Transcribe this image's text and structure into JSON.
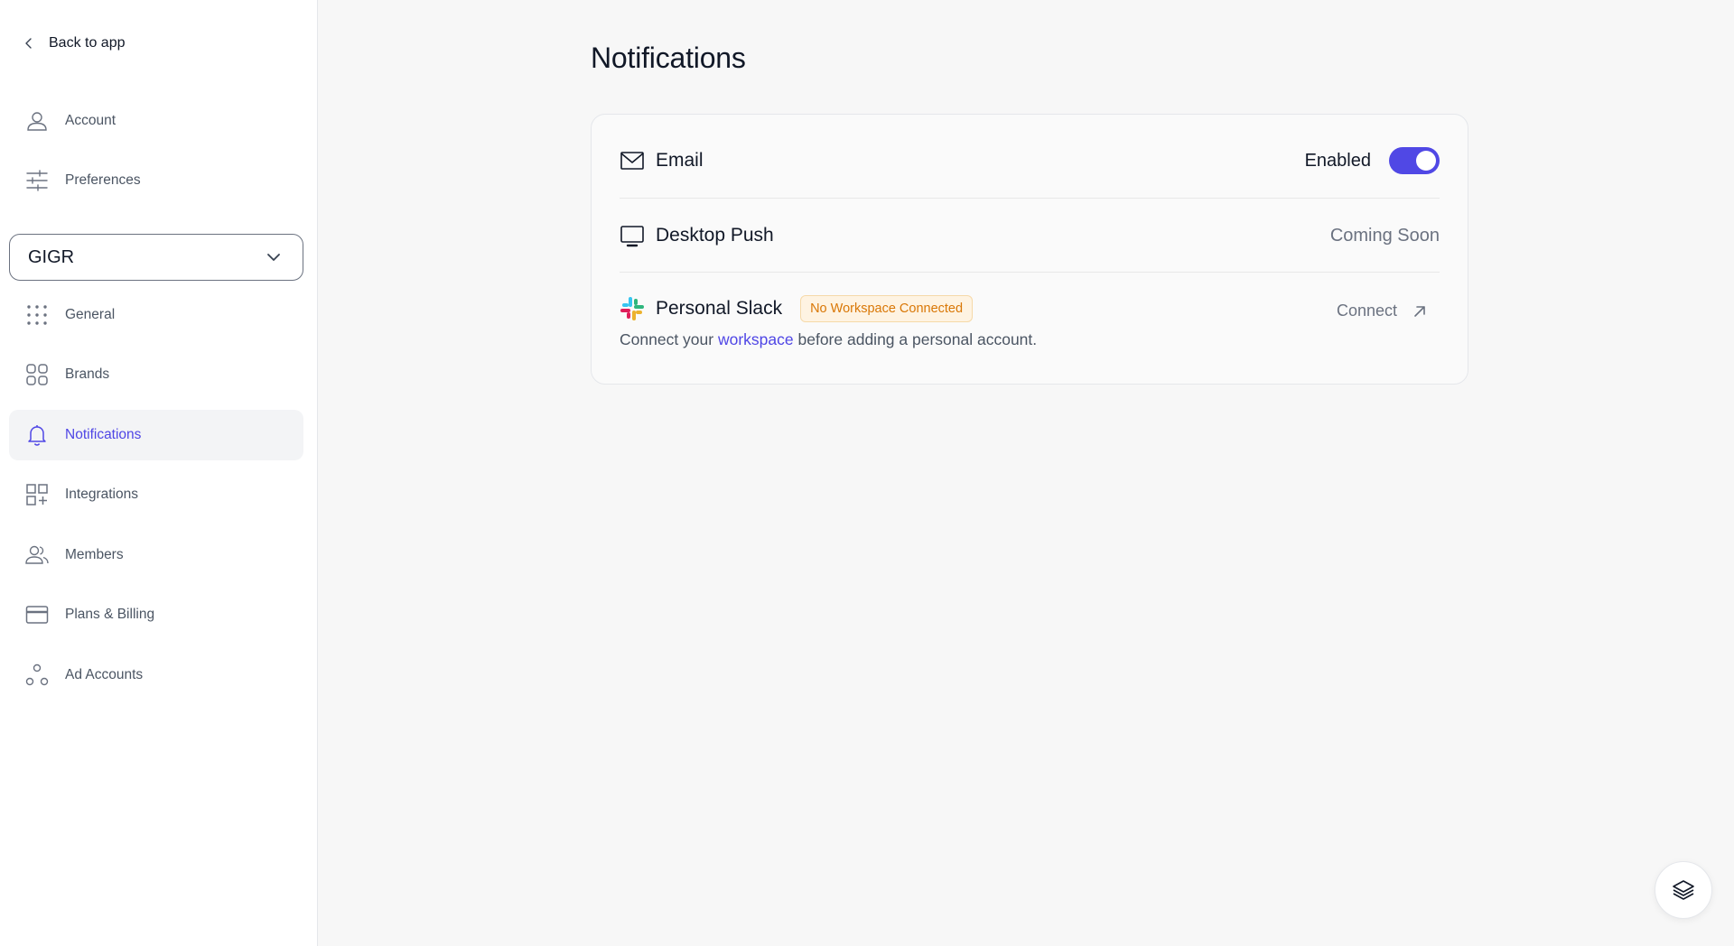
{
  "sidebar": {
    "back_label": "Back to app",
    "items_top": [
      {
        "label": "Account",
        "icon": "user-icon"
      },
      {
        "label": "Preferences",
        "icon": "sliders-icon"
      }
    ],
    "workspace": {
      "selected": "GIGR"
    },
    "items_workspace": [
      {
        "label": "General",
        "icon": "dots-grid-icon"
      },
      {
        "label": "Brands",
        "icon": "grid-four-icon"
      },
      {
        "label": "Notifications",
        "icon": "bell-icon",
        "active": true
      },
      {
        "label": "Integrations",
        "icon": "grid-plus-icon"
      },
      {
        "label": "Members",
        "icon": "users-icon"
      },
      {
        "label": "Plans & Billing",
        "icon": "credit-card-icon"
      },
      {
        "label": "Ad Accounts",
        "icon": "nodes-icon"
      }
    ]
  },
  "main": {
    "title": "Notifications",
    "email": {
      "label": "Email",
      "status": "Enabled",
      "enabled": true
    },
    "desktop_push": {
      "label": "Desktop Push",
      "status": "Coming Soon"
    },
    "slack": {
      "label": "Personal Slack",
      "badge": "No Workspace Connected",
      "desc_before": "Connect your",
      "desc_link": "workspace",
      "desc_after": "before adding a personal account.",
      "connect_label": "Connect"
    }
  },
  "colors": {
    "accent": "#4f46e5",
    "badge_text": "#d97706",
    "badge_bg": "#fef3e2"
  }
}
